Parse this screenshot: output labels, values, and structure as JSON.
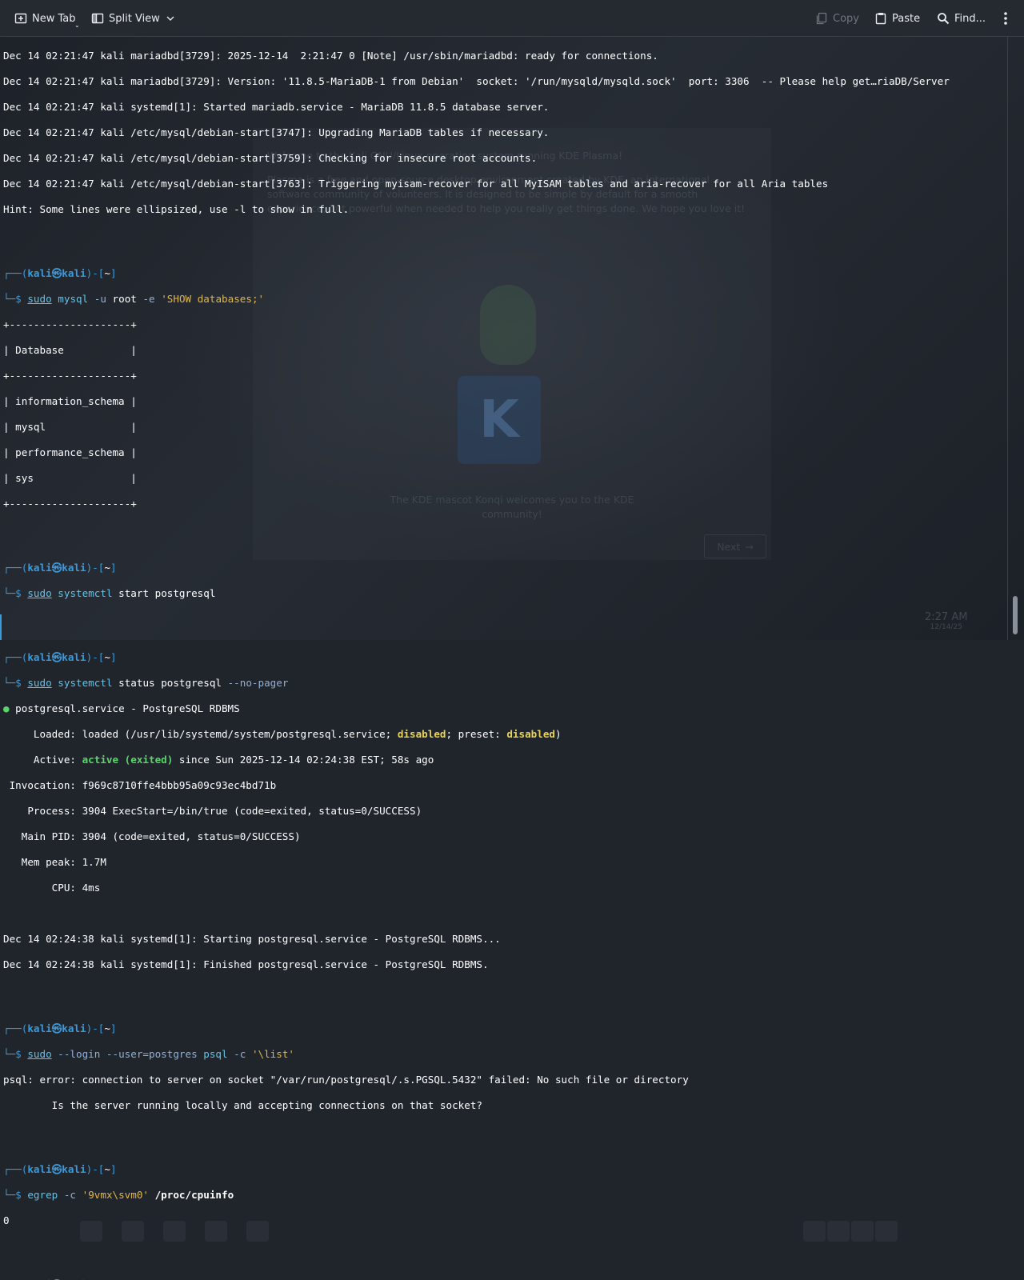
{
  "toolbar": {
    "new_tab": "New Tab",
    "split_view": "Split View",
    "copy": "Copy",
    "paste": "Paste",
    "find": "Find..."
  },
  "background": {
    "welcome_title": "Welcome to the Kali GNU/Linux operating system running KDE Plasma!",
    "welcome_body": "Plasma is a free and open-source desktop environment created by KDE, an international software community of volunteers. It is designed to be simple by default for a smooth experience, but powerful when needed to help you really get things done. We hope you love it!",
    "mascot_caption": "The KDE mascot Konqi welcomes you to the KDE community!",
    "next": "Next",
    "clock_time": "2:27 AM",
    "clock_date": "12/14/25"
  },
  "terminal": {
    "log1": "Dec 14 02:21:47 kali mariadbd[3729]: 2025-12-14  2:21:47 0 [Note] /usr/sbin/mariadbd: ready for connections.",
    "log2": "Dec 14 02:21:47 kali mariadbd[3729]: Version: '11.8.5-MariaDB-1 from Debian'  socket: '/run/mysqld/mysqld.sock'  port: 3306  -- Please help get…riaDB/Server",
    "log3": "Dec 14 02:21:47 kali systemd[1]: Started mariadb.service - MariaDB 11.8.5 database server.",
    "log4": "Dec 14 02:21:47 kali /etc/mysql/debian-start[3747]: Upgrading MariaDB tables if necessary.",
    "log5": "Dec 14 02:21:47 kali /etc/mysql/debian-start[3759]: Checking for insecure root accounts.",
    "log6": "Dec 14 02:21:47 kali /etc/mysql/debian-start[3763]: Triggering myisam-recover for all MyISAM tables and aria-recover for all Aria tables",
    "hint": "Hint: Some lines were ellipsized, use -l to show in full.",
    "prompt_user": "kali",
    "prompt_at": "㉿",
    "prompt_host": "kali",
    "prompt_dir": "~",
    "cmd1": {
      "sudo": "sudo",
      "bin": "mysql",
      "a": " -u",
      "b": " root ",
      "c": "-e",
      "d": " ",
      "s": "'SHOW databases;'"
    },
    "table": [
      "+--------------------+",
      "| Database           |",
      "+--------------------+",
      "| information_schema |",
      "| mysql              |",
      "| performance_schema |",
      "| sys                |",
      "+--------------------+"
    ],
    "cmd2": {
      "sudo": "sudo",
      "bin": "systemctl",
      "rest": " start postgresql"
    },
    "cmd3": {
      "sudo": "sudo",
      "bin": "systemctl",
      "rest": " status postgresql ",
      "flag": "--no-pager"
    },
    "status": {
      "svc": " postgresql.service - PostgreSQL RDBMS",
      "loaded_pre": "     Loaded: loaded (/usr/lib/systemd/system/postgresql.service; ",
      "disabled1": "disabled",
      "loaded_mid": "; preset: ",
      "disabled2": "disabled",
      "loaded_end": ")",
      "active_pre": "     Active: ",
      "active_val": "active (exited)",
      "active_post": " since Sun 2025-12-14 02:24:38 EST; 58s ago",
      "invocation": " Invocation: f969c8710ffe4bbb95a09c93ec4bd71b",
      "process": "    Process: 3904 ExecStart=/bin/true (code=exited, status=0/SUCCESS)",
      "mainpid": "   Main PID: 3904 (code=exited, status=0/SUCCESS)",
      "mempeak": "   Mem peak: 1.7M",
      "cpu": "        CPU: 4ms",
      "j1": "Dec 14 02:24:38 kali systemd[1]: Starting postgresql.service - PostgreSQL RDBMS...",
      "j2": "Dec 14 02:24:38 kali systemd[1]: Finished postgresql.service - PostgreSQL RDBMS."
    },
    "cmd4": {
      "sudo": "sudo",
      "flag1": " --login --user=postgres ",
      "bin": "psql",
      "flag2": " -c ",
      "s": "'\\list'"
    },
    "err1": "psql: error: connection to server on socket \"/var/run/postgresql/.s.PGSQL.5432\" failed: No such file or directory",
    "err2": "        Is the server running locally and accepting connections on that socket?",
    "cmd5": {
      "bin": "egrep",
      "flag": " -c ",
      "s": "'9vmx\\svm0'",
      "path": " /proc/cpuinfo"
    },
    "out5": "0"
  }
}
